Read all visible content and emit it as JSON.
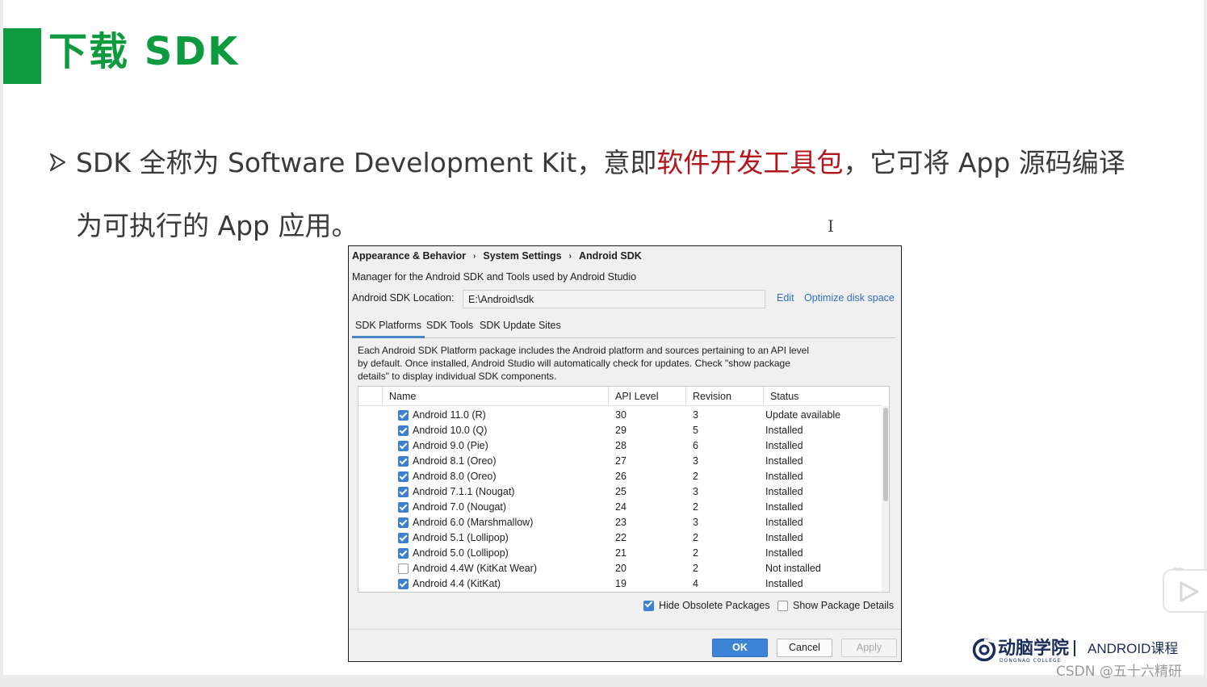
{
  "slide": {
    "title": "下载 SDK",
    "bullet_line1_a": "SDK 全称为 Software Development Kit，意即",
    "bullet_line1_highlight": "软件开发工具包",
    "bullet_line1_b": "，它可将 App 源码编译",
    "bullet_line2": "为可执行的 App 应用。",
    "highlight_color": "#b4151b",
    "accent_color": "#0e9a3e"
  },
  "dialog": {
    "breadcrumb": [
      "Appearance & Behavior",
      "System Settings",
      "Android SDK"
    ],
    "breadcrumb_separator": "›",
    "description": "Manager for the Android SDK and Tools used by Android Studio",
    "sdk_location_label": "Android SDK Location:",
    "sdk_location_value": "E:\\Android\\sdk",
    "edit_link": "Edit",
    "optimize_link": "Optimize disk space",
    "tabs": [
      "SDK Platforms",
      "SDK Tools",
      "SDK Update Sites"
    ],
    "active_tab": "SDK Platforms",
    "panel_description": "Each Android SDK Platform package includes the Android platform and sources pertaining to an API level by default. Once installed, Android Studio will automatically check for updates. Check \"show package details\" to display individual SDK components.",
    "columns": [
      "Name",
      "API Level",
      "Revision",
      "Status"
    ],
    "rows": [
      {
        "checked": true,
        "name": "Android 11.0 (R)",
        "api": "30",
        "revision": "3",
        "status": "Update available"
      },
      {
        "checked": true,
        "name": "Android 10.0 (Q)",
        "api": "29",
        "revision": "5",
        "status": "Installed"
      },
      {
        "checked": true,
        "name": "Android 9.0 (Pie)",
        "api": "28",
        "revision": "6",
        "status": "Installed"
      },
      {
        "checked": true,
        "name": "Android 8.1 (Oreo)",
        "api": "27",
        "revision": "3",
        "status": "Installed"
      },
      {
        "checked": true,
        "name": "Android 8.0 (Oreo)",
        "api": "26",
        "revision": "2",
        "status": "Installed"
      },
      {
        "checked": true,
        "name": "Android 7.1.1 (Nougat)",
        "api": "25",
        "revision": "3",
        "status": "Installed"
      },
      {
        "checked": true,
        "name": "Android 7.0 (Nougat)",
        "api": "24",
        "revision": "2",
        "status": "Installed"
      },
      {
        "checked": true,
        "name": "Android 6.0 (Marshmallow)",
        "api": "23",
        "revision": "3",
        "status": "Installed"
      },
      {
        "checked": true,
        "name": "Android 5.1 (Lollipop)",
        "api": "22",
        "revision": "2",
        "status": "Installed"
      },
      {
        "checked": true,
        "name": "Android 5.0 (Lollipop)",
        "api": "21",
        "revision": "2",
        "status": "Installed"
      },
      {
        "checked": false,
        "name": "Android 4.4W (KitKat Wear)",
        "api": "20",
        "revision": "2",
        "status": "Not installed"
      },
      {
        "checked": true,
        "name": "Android 4.4 (KitKat)",
        "api": "19",
        "revision": "4",
        "status": "Installed"
      }
    ],
    "hide_obsolete": {
      "label": "Hide Obsolete Packages",
      "checked": true
    },
    "show_details": {
      "label": "Show Package Details",
      "checked": false
    },
    "buttons": {
      "ok": "OK",
      "cancel": "Cancel",
      "apply": "Apply"
    },
    "link_color": "#2f6fc4",
    "primary_button_color": "#3d84d6"
  },
  "branding": {
    "logo_name": "动脑学院",
    "logo_subtitle": "DONGNAO COLLEGE",
    "course": "ANDROID课程",
    "watermark": "CSDN @五十六精研"
  },
  "icons": {
    "bullet": "arrow-bullet-icon",
    "cursor": "text-cursor-icon",
    "logo": "dongnao-logo-icon",
    "video": "video-play-icon"
  }
}
